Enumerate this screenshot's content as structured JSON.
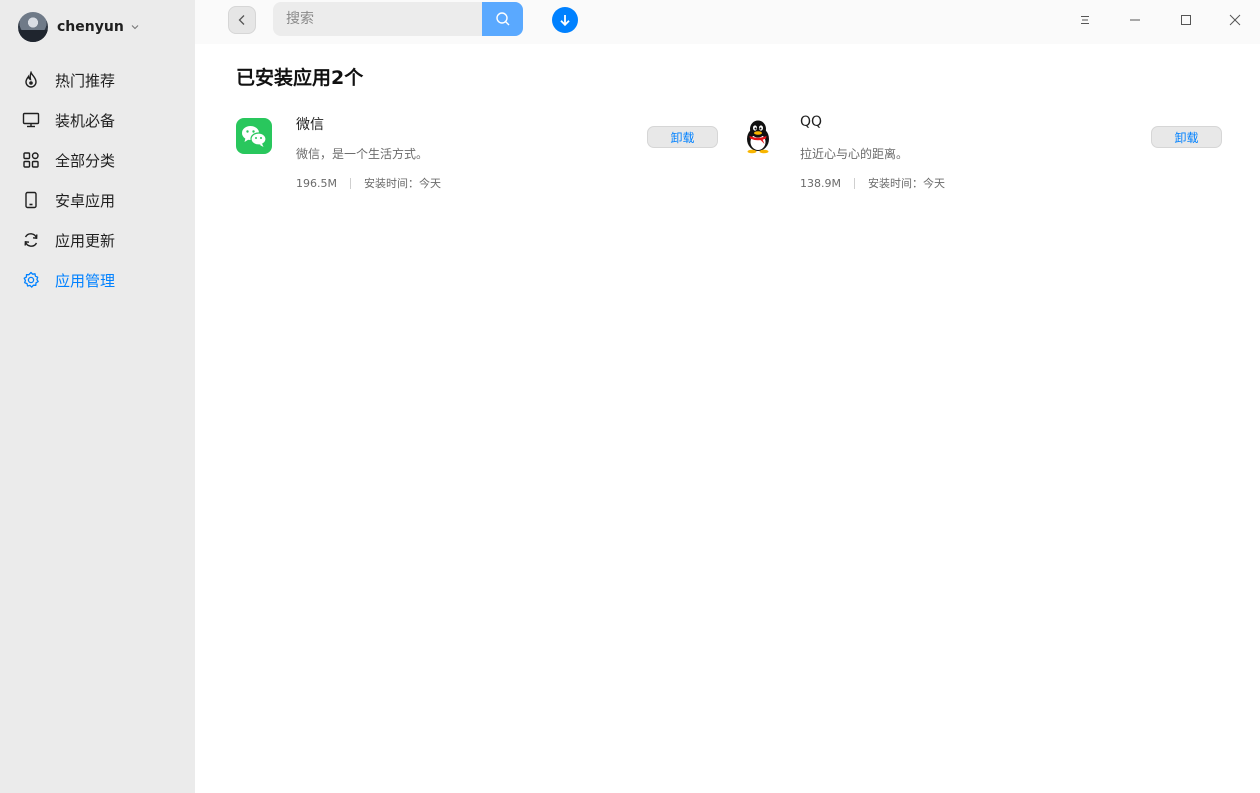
{
  "sidebar": {
    "user": {
      "name": "chenyun"
    },
    "items": [
      {
        "label": "热门推荐",
        "icon": "flame-icon"
      },
      {
        "label": "装机必备",
        "icon": "monitor-icon"
      },
      {
        "label": "全部分类",
        "icon": "grid-icon"
      },
      {
        "label": "安卓应用",
        "icon": "phone-icon"
      },
      {
        "label": "应用更新",
        "icon": "refresh-icon"
      },
      {
        "label": "应用管理",
        "icon": "gear-icon",
        "active": true
      }
    ]
  },
  "header": {
    "search_placeholder": "搜索"
  },
  "main": {
    "title": "已安装应用2个",
    "apps": [
      {
        "name": "微信",
        "description": "微信，是一个生活方式。",
        "size": "196.5M",
        "install_time": "安装时间：今天",
        "action": "卸载",
        "icon": "wechat-icon"
      },
      {
        "name": "QQ",
        "description": "拉近心与心的距离。",
        "size": "138.9M",
        "install_time": "安装时间：今天",
        "action": "卸载",
        "icon": "qq-icon"
      }
    ]
  },
  "colors": {
    "accent": "#0081ff",
    "sidebar_bg": "#ebebeb",
    "search_button": "#5aa9ff"
  }
}
